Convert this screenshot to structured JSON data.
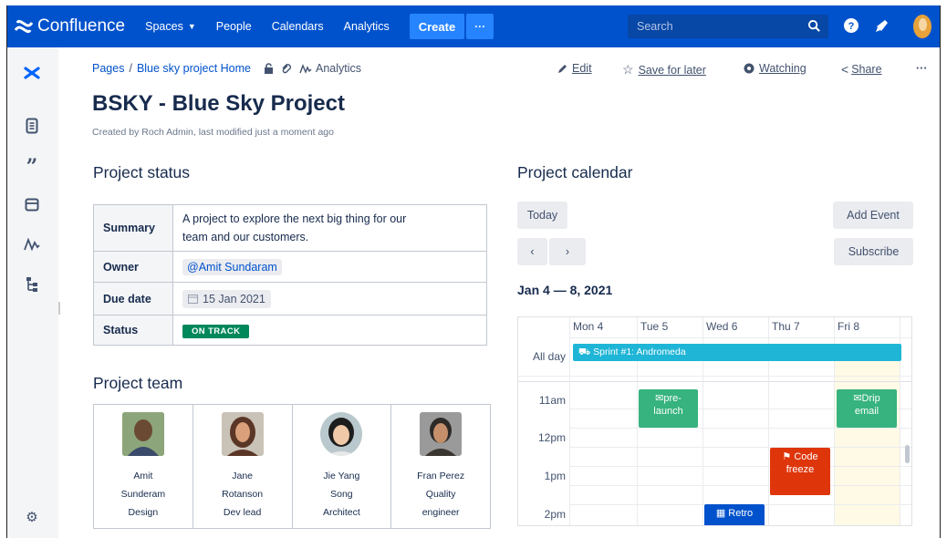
{
  "app": {
    "name": "Confluence"
  },
  "nav": {
    "spaces": "Spaces",
    "people": "People",
    "calendars": "Calendars",
    "analytics": "Analytics",
    "create": "Create",
    "more": "···",
    "search_placeholder": "Search"
  },
  "breadcrumb": {
    "pages": "Pages",
    "sep": "/",
    "home": "Blue sky project Home",
    "analytics": "Analytics"
  },
  "actions": {
    "edit": "Edit",
    "save": "Save for later",
    "watching": "Watching",
    "share": "Share",
    "more": "···"
  },
  "page": {
    "title": "BSKY - Blue Sky Project",
    "byline": "Created by Roch Admin, last modified just a moment ago"
  },
  "status": {
    "heading": "Project status",
    "rows": [
      {
        "key": "Summary",
        "value_line1": "A project to explore the next big thing for our",
        "value_line2": "team and our customers."
      },
      {
        "key": "Owner",
        "value": "@Amit Sundaram"
      },
      {
        "key": "Due date",
        "value": "15 Jan 2021"
      },
      {
        "key": "Status",
        "value": "ON TRACK"
      }
    ]
  },
  "team": {
    "heading": "Project team",
    "members": [
      {
        "first": "Amit",
        "last": "Sunderam",
        "role": "Design"
      },
      {
        "first": "Jane",
        "last": "Rotanson",
        "role": "Dev lead"
      },
      {
        "first": "Jie Yang",
        "last": "Song",
        "role": "Architect"
      },
      {
        "first": "Fran Perez",
        "last": "Quality",
        "role": "engineer"
      }
    ]
  },
  "calendar": {
    "heading": "Project calendar",
    "today": "Today",
    "add_event": "Add Event",
    "subscribe": "Subscribe",
    "prev": "‹",
    "next": "›",
    "range": "Jan 4 — 8, 2021",
    "days": [
      "Mon 4",
      "Tue 5",
      "Wed 6",
      "Thu 7",
      "Fri 8"
    ],
    "all_day_label": "All day",
    "times": [
      "11am",
      "12pm",
      "1pm",
      "2pm"
    ],
    "events": {
      "sprint": "Sprint #1: Andromeda",
      "prelaunch_1": "pre-",
      "prelaunch_2": "launch",
      "drip_1": "Drip",
      "drip_2": "email",
      "code_1": "Code",
      "code_2": "freeze",
      "retro": "Retro"
    },
    "colors": {
      "sprint": "#1fb5d6",
      "prelaunch": "#36b37e",
      "drip": "#36b37e",
      "code": "#de350b",
      "retro": "#0052cc",
      "today_col": "#fffae6"
    }
  }
}
